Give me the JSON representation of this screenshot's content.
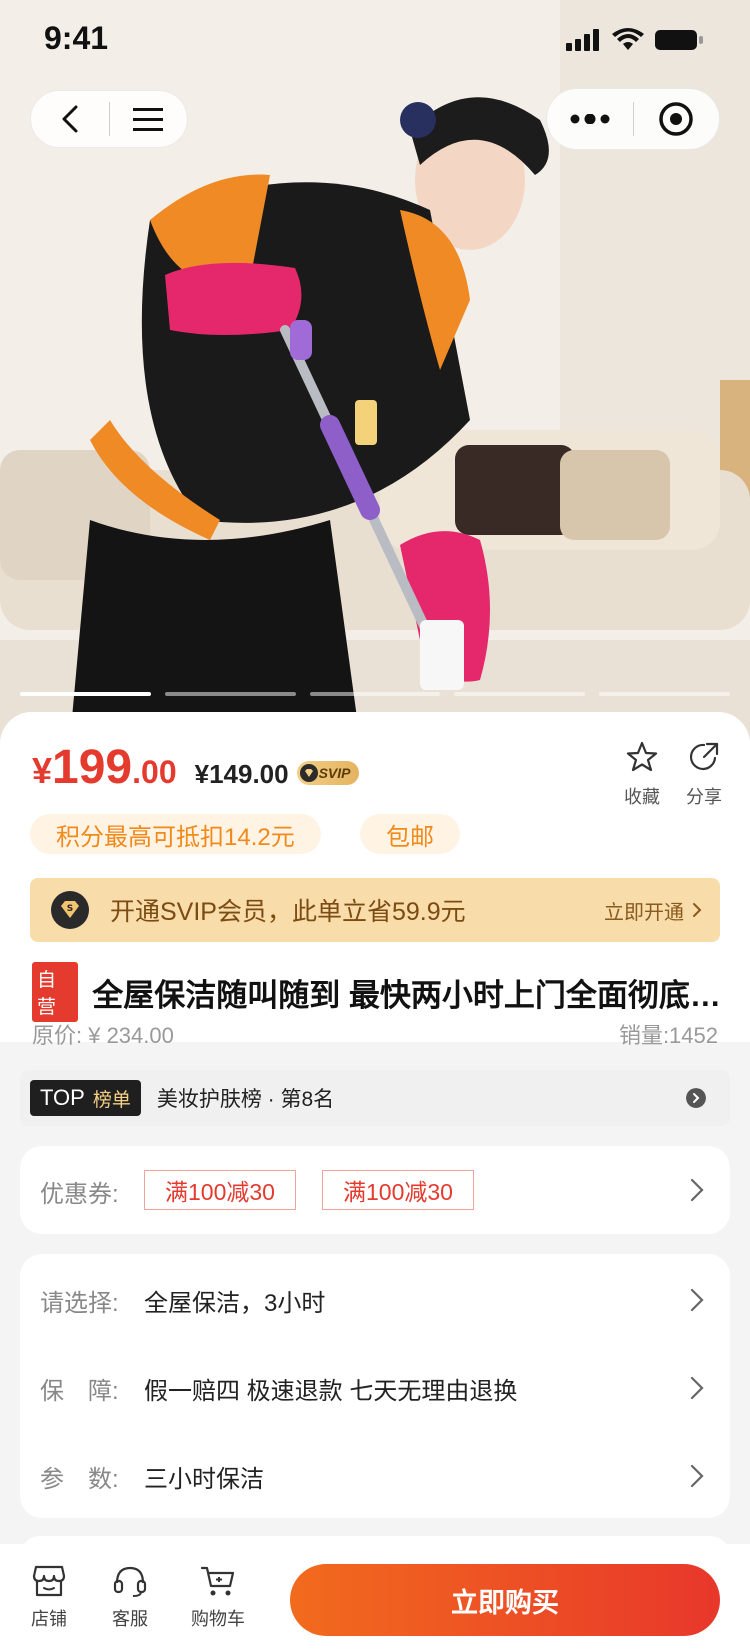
{
  "status_bar": {
    "time": "9:41"
  },
  "nav": {
    "back_icon": "chevron-left-icon",
    "menu_icon": "hamburger-icon",
    "more_icon": "more-dots-icon",
    "record_icon": "target-icon"
  },
  "hero": {
    "image": "cleaner-with-mop",
    "indicators": 5,
    "active_indicator": 1
  },
  "price": {
    "symbol": "¥",
    "integer": "199",
    "decimal": ".00",
    "vip_price": "¥149.00",
    "vip_badge": "SVIP"
  },
  "actions": {
    "favorite_label": "收藏",
    "share_label": "分享"
  },
  "pills": {
    "points": "积分最高可抵扣14.2元",
    "shipping": "包邮"
  },
  "svip_bar": {
    "text": "开通SVIP会员，此单立省59.9元",
    "open_label": "立即开通"
  },
  "product": {
    "self_badge": "自营",
    "title": "全屋保洁随叫随到 最快两小时上门全面彻底清洁",
    "original_price": "原价: ¥ 234.00",
    "sales": "销量:1452"
  },
  "rank": {
    "top_label": "TOP",
    "list_label": "榜单",
    "text": "美妆护肤榜 · 第8名"
  },
  "coupons": {
    "label": "优惠券:",
    "items": [
      "满100减30",
      "满100减30"
    ]
  },
  "options": [
    {
      "key": "请选择:",
      "value": "全屋保洁，3小时"
    },
    {
      "key": "保　障:",
      "value": "假一赔四 极速退款 七天无理由退换"
    },
    {
      "key": "参　数:",
      "value": "三小时保洁"
    }
  ],
  "bottom_bar": {
    "store_label": "店铺",
    "service_label": "客服",
    "cart_label": "购物车",
    "buy_label": "立即购买"
  },
  "colors": {
    "accent_red": "#e53a2e",
    "orange": "#f08a1b",
    "svip_gold": "#f8dcaa"
  }
}
